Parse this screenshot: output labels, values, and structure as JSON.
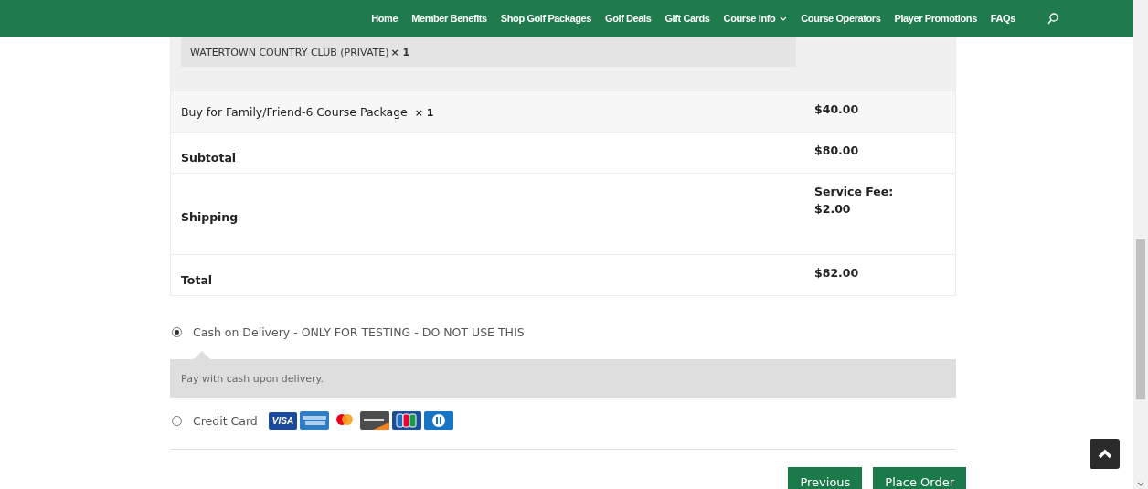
{
  "nav": {
    "items": [
      {
        "label": "Home",
        "kind": "link"
      },
      {
        "label": "Member Benefits",
        "kind": "link"
      },
      {
        "label": "Shop Golf Packages",
        "kind": "link"
      },
      {
        "label": "Golf Deals",
        "kind": "link"
      },
      {
        "label": "Gift Cards",
        "kind": "link"
      },
      {
        "label": "Course Info",
        "kind": "dropdown"
      },
      {
        "label": "Course Operators",
        "kind": "link"
      },
      {
        "label": "Player Promotions",
        "kind": "link"
      },
      {
        "label": "FAQs",
        "kind": "link"
      }
    ]
  },
  "order": {
    "course_line": {
      "name": "WATERTOWN COUNTRY CLUB (PRIVATE)",
      "qty": "× 1"
    },
    "rows": [
      {
        "kind": "item",
        "label": "Buy for Family/Friend-6 Course Package",
        "qty": "× 1",
        "value": [
          "$40.00"
        ]
      },
      {
        "kind": "total",
        "label": "Subtotal",
        "value": [
          "$80.00"
        ]
      },
      {
        "kind": "total",
        "label": "Shipping",
        "value": [
          "Service Fee:",
          "$2.00"
        ]
      },
      {
        "kind": "total",
        "label": "Total",
        "value": [
          "$82.00"
        ]
      }
    ]
  },
  "payment": {
    "methods": [
      {
        "label": "Cash on Delivery - ONLY FOR TESTING - DO NOT USE THIS",
        "selected": true,
        "description": "Pay with cash upon delivery."
      },
      {
        "label": "Credit Card",
        "selected": false,
        "card_text": "VISA"
      }
    ]
  },
  "buttons": [
    "Previous",
    "Place Order"
  ]
}
